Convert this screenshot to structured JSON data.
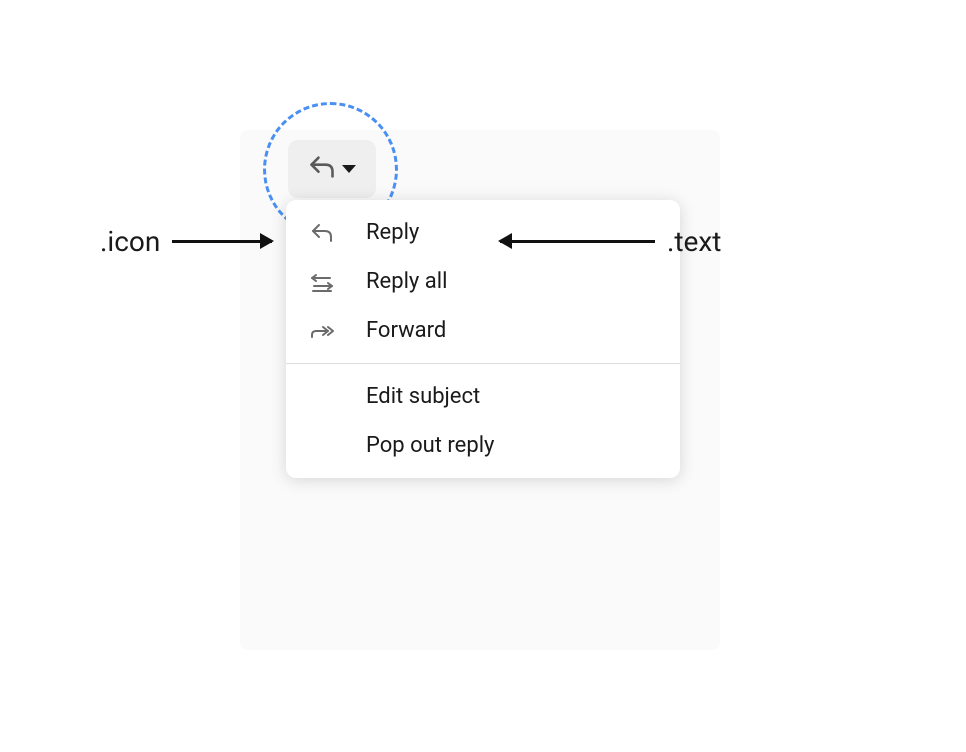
{
  "annotations": {
    "icon_label": ".icon",
    "text_label": ".text"
  },
  "menu": {
    "items": [
      {
        "icon": "reply",
        "label": "Reply"
      },
      {
        "icon": "reply-all",
        "label": "Reply all"
      },
      {
        "icon": "forward",
        "label": "Forward"
      }
    ],
    "secondary_items": [
      {
        "label": "Edit subject"
      },
      {
        "label": "Pop out reply"
      }
    ]
  }
}
